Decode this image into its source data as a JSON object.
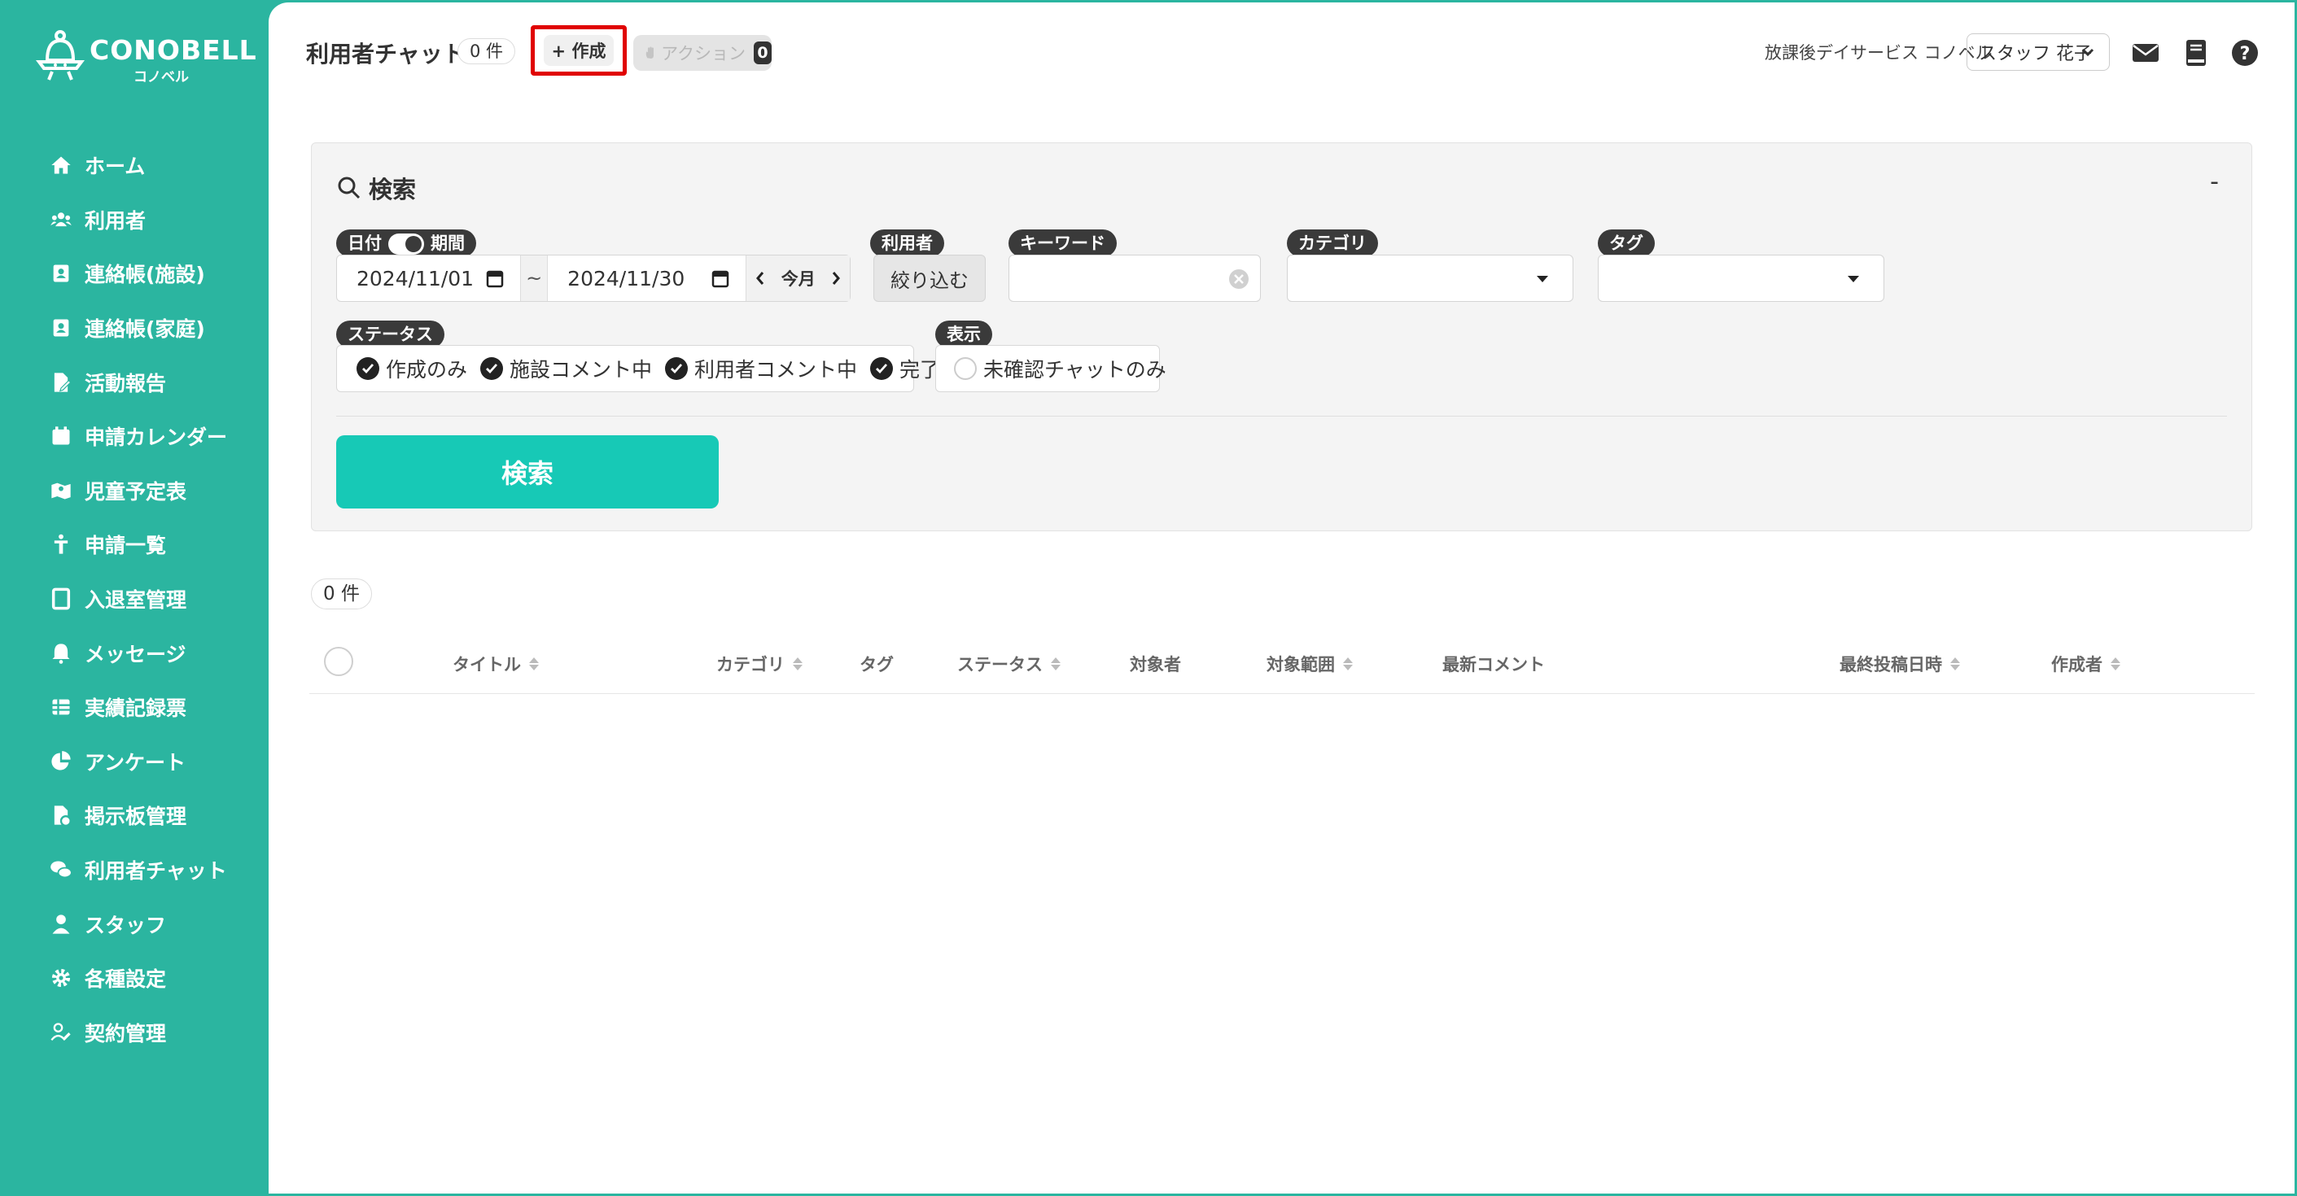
{
  "brand": {
    "name": "CONOBELL",
    "sub": "コノベル"
  },
  "sidebar": {
    "items": [
      {
        "label": "ホーム",
        "icon": "home-icon"
      },
      {
        "label": "利用者",
        "icon": "users-icon"
      },
      {
        "label": "連絡帳(施設)",
        "icon": "contact-book-icon"
      },
      {
        "label": "連絡帳(家庭)",
        "icon": "contact-book-icon"
      },
      {
        "label": "活動報告",
        "icon": "report-icon"
      },
      {
        "label": "申請カレンダー",
        "icon": "calendar-icon"
      },
      {
        "label": "児童予定表",
        "icon": "map-icon"
      },
      {
        "label": "申請一覧",
        "icon": "person-icon"
      },
      {
        "label": "入退室管理",
        "icon": "tablet-icon"
      },
      {
        "label": "メッセージ",
        "icon": "bell-icon"
      },
      {
        "label": "実績記録票",
        "icon": "table-icon"
      },
      {
        "label": "アンケート",
        "icon": "pie-chart-icon"
      },
      {
        "label": "掲示板管理",
        "icon": "board-icon"
      },
      {
        "label": "利用者チャット",
        "icon": "chat-icon"
      },
      {
        "label": "スタッフ",
        "icon": "staff-icon"
      },
      {
        "label": "各種設定",
        "icon": "gear-icon"
      },
      {
        "label": "契約管理",
        "icon": "contract-icon"
      }
    ]
  },
  "header": {
    "title": "利用者チャット",
    "count": "0 件",
    "create_label": "+ 作成",
    "action_label": "アクション",
    "action_count": "0",
    "facility": "放課後デイサービス コノベル",
    "staff": "スタッフ 花子"
  },
  "search": {
    "title": "検索",
    "collapse": "-",
    "date_label": "日付",
    "period_label": "期間",
    "date_from": "2024/11/01",
    "date_to": "2024/11/30",
    "tilde": "~",
    "month_label": "今月",
    "user_label": "利用者",
    "narrow_label": "絞り込む",
    "keyword_label": "キーワード",
    "keyword_value": "",
    "category_label": "カテゴリ",
    "tag_label": "タグ",
    "status_label": "ステータス",
    "statuses": [
      {
        "label": "作成のみ",
        "checked": true
      },
      {
        "label": "施設コメント中",
        "checked": true
      },
      {
        "label": "利用者コメント中",
        "checked": true
      },
      {
        "label": "完了",
        "checked": true
      }
    ],
    "display_label": "表示",
    "display_option": {
      "label": "未確認チャットのみ",
      "checked": false
    },
    "search_button": "検索"
  },
  "results": {
    "count": "0 件",
    "columns": [
      "タイトル",
      "カテゴリ",
      "タグ",
      "ステータス",
      "対象者",
      "対象範囲",
      "最新コメント",
      "最終投稿日時",
      "作成者"
    ]
  },
  "colors": {
    "accent": "#2bb5a0",
    "search_button": "#17c9b6",
    "highlight": "#e00000"
  }
}
